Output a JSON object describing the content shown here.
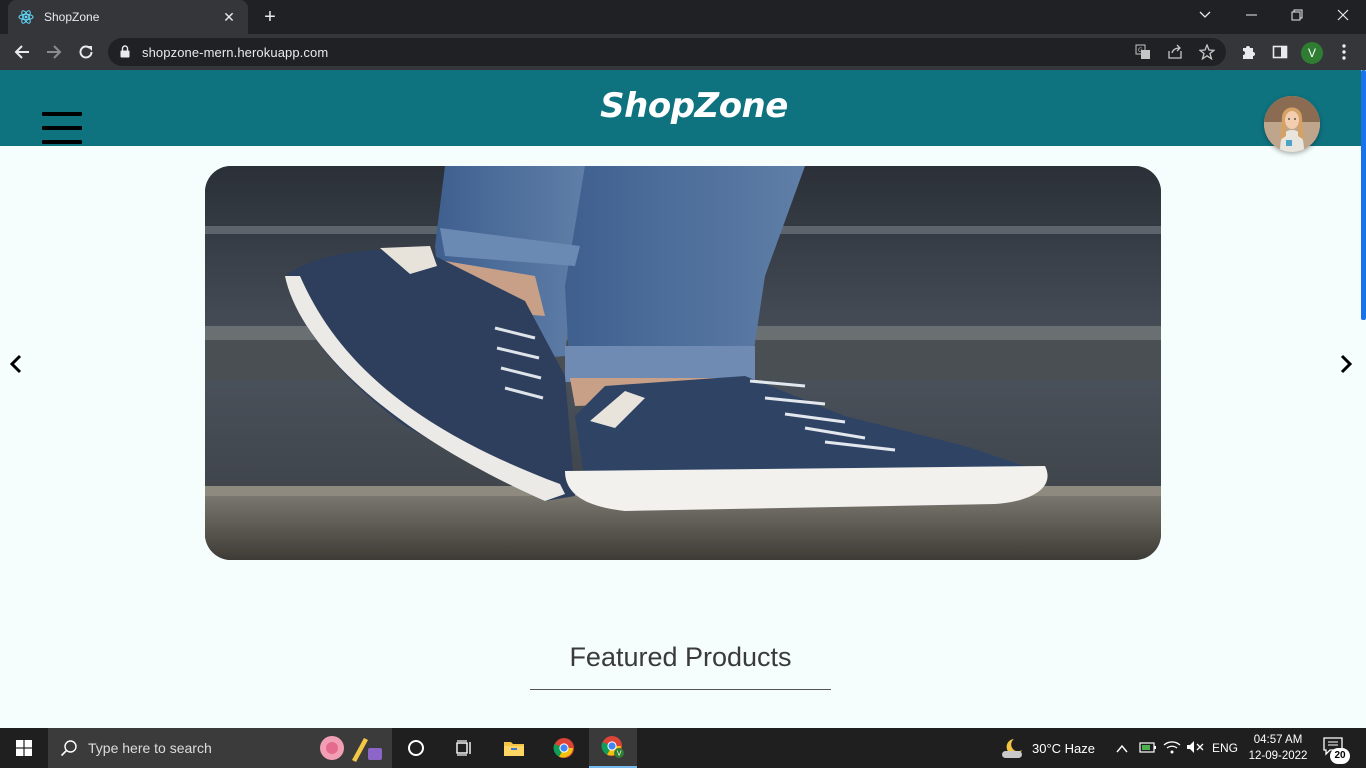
{
  "browser": {
    "tab_title": "ShopZone",
    "url": "shopzone-mern.herokuapp.com",
    "profile_initial": "V"
  },
  "site": {
    "logo": "ShopZone",
    "featured_title": "Featured Products",
    "colors": {
      "header": "#0e737f",
      "background": "#f6fdfd"
    }
  },
  "taskbar": {
    "search_placeholder": "Type here to search",
    "weather": "30°C  Haze",
    "language": "ENG",
    "time": "04:57 AM",
    "date": "12-09-2022",
    "notification_count": "20"
  }
}
